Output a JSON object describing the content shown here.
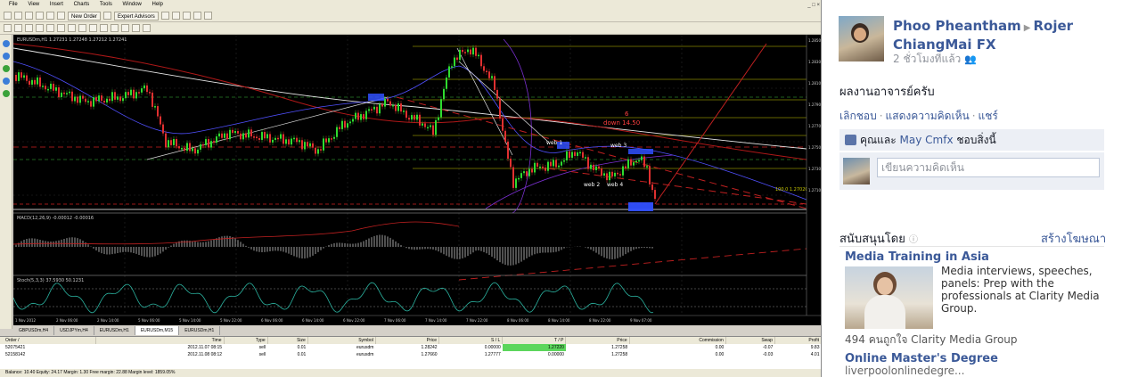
{
  "mt4": {
    "menu": [
      "File",
      "View",
      "Insert",
      "Charts",
      "Tools",
      "Window",
      "Help"
    ],
    "toolbar": {
      "new_order": "New Order",
      "expert_advisors": "Expert Advisors"
    },
    "chart_title": "EURUSDm,H1 1.27231 1.27248 1.27212 1.27241",
    "indicator1_label": "MACD(12,26,9) -0.00012 -0.00016",
    "indicator2_label": "Stoch(5,3,3) 37.5930 50.1231",
    "annotations": {
      "six": "6",
      "down": "down 14.50",
      "web1": "web 1",
      "web2": "web 2",
      "web3": "web 3",
      "web4": "web 4",
      "level": "100.0 1.27020"
    },
    "price_ticks": [
      "1.2850",
      "1.2830",
      "1.2810",
      "1.2790",
      "1.2770",
      "1.2750",
      "1.2730",
      "1.2710"
    ],
    "time_ticks": [
      "1 Nov 2012",
      "2 Nov 06:00",
      "2 Nov 14:00",
      "5 Nov 06:00",
      "5 Nov 14:00",
      "5 Nov 22:00",
      "6 Nov 06:00",
      "6 Nov 14:00",
      "6 Nov 22:00",
      "7 Nov 06:00",
      "7 Nov 14:00",
      "7 Nov 22:00",
      "8 Nov 06:00",
      "8 Nov 14:00",
      "8 Nov 22:00",
      "9 Nov 07:00"
    ],
    "tabs": [
      "GBPUSDm,H4",
      "USDJPYm,H4",
      "EURUSDm,H1",
      "EURUSDm,M15",
      "EURUSDm,H1"
    ],
    "active_tab": 3,
    "terminal": {
      "headers": [
        "Order /",
        "Time",
        "Type",
        "Size",
        "Symbol",
        "Price",
        "S / L",
        "T / P",
        "Price",
        "Commission",
        "Swap",
        "Profit"
      ],
      "rows": [
        [
          "52075421",
          "2012.11.07 08:15",
          "sell",
          "0.01",
          "eurusdm",
          "1.28242",
          "0.00000",
          "1.27220",
          "1.27258",
          "0.00",
          "-0.07",
          "9.83"
        ],
        [
          "52158142",
          "2012.11.08 08:12",
          "sell",
          "0.01",
          "eurusdm",
          "1.27660",
          "1.27777",
          "0.00000",
          "1.27258",
          "0.00",
          "-0.03",
          "4.01"
        ]
      ],
      "balance": "Balance: 10.40  Equity: 24.17  Margin: 1.30  Free margin: 22.88  Margin level: 1859.05%"
    }
  },
  "fb": {
    "poster_name": "Phoo Pheantham",
    "target_name": "Rojer ChiangMai FX",
    "time": "2 ชั่วโมงที่แล้ว",
    "message": "ผลงานอาจารย์ครับ",
    "actions": [
      "เลิกชอบ",
      "แสดงความคิดเห็น",
      "แชร์"
    ],
    "likes_prefix": "คุณและ",
    "likes_name": "May Cmfx",
    "likes_suffix": "ชอบสิ่งนี้",
    "comment_placeholder": "เขียนความคิดเห็น",
    "sponsored": "สนับสนุนโดย",
    "create_ad": "สร้างโฆษณา",
    "ad1": {
      "title": "Media Training in Asia",
      "body": "Media interviews, speeches, panels: Prep with the professionals at Clarity Media Group.",
      "likes": "494 คนถูกใจ Clarity Media Group"
    },
    "ad2": {
      "title": "Online Master's Degree",
      "url": "liverpoolonlinedegre..."
    }
  }
}
